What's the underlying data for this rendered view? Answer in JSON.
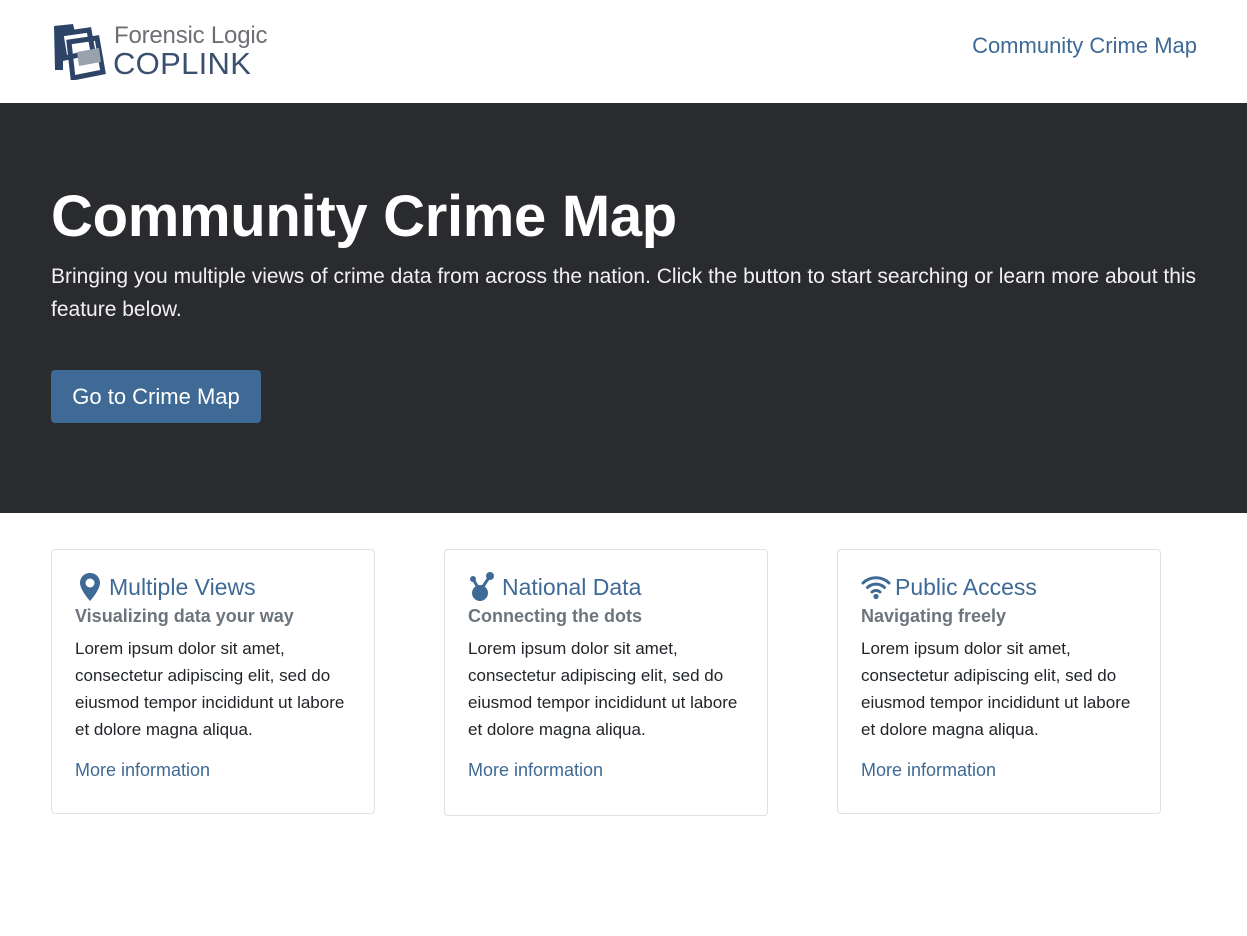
{
  "header": {
    "logo_line1": "Forensic Logic",
    "logo_line2": "COPLINK",
    "nav_link": "Community Crime Map"
  },
  "hero": {
    "title": "Community Crime Map",
    "lead": "Bringing you multiple views of crime data from across the nation. Click the button to start searching or learn more about this feature below.",
    "button_label": "Go to Crime Map"
  },
  "cards": [
    {
      "icon": "map-marker-icon",
      "title": "Multiple Views",
      "subtitle": "Visualizing data your way",
      "text": "Lorem ipsum dolor sit amet, consectetur adipiscing elit, sed do eiusmod tempor incididunt ut labore et dolore magna aliqua.",
      "link": "More information"
    },
    {
      "icon": "connection-nodes-icon",
      "title": "National Data",
      "subtitle": "Connecting the dots",
      "text": "Lorem ipsum dolor sit amet, consectetur adipiscing elit, sed do eiusmod tempor incididunt ut labore et dolore magna aliqua.",
      "link": "More information"
    },
    {
      "icon": "wifi-icon",
      "title": "Public Access",
      "subtitle": "Navigating freely",
      "text": "Lorem ipsum dolor sit amet, consectetur adipiscing elit, sed do eiusmod tempor incididunt ut labore et dolore magna aliqua.",
      "link": "More information"
    }
  ],
  "colors": {
    "accent": "#3f6a95",
    "hero_bg": "#2a2b2e",
    "muted": "#6c757d"
  }
}
